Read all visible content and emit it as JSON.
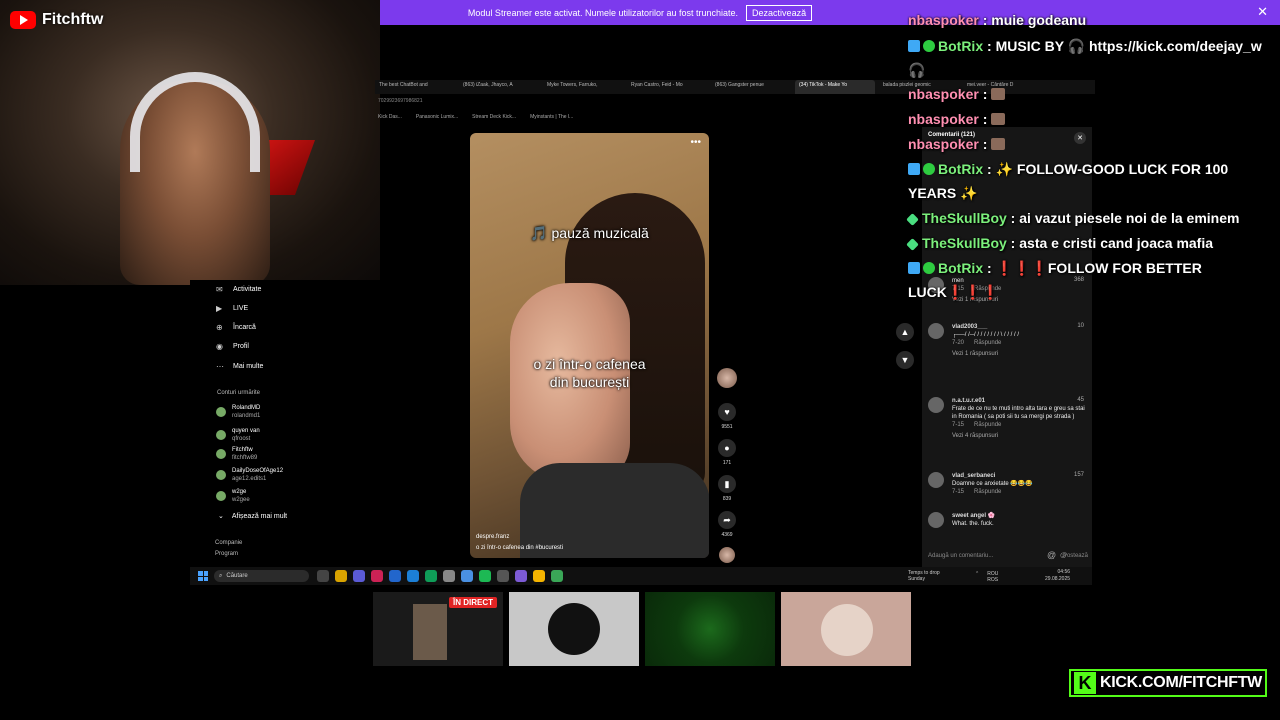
{
  "webcam": {
    "channel_name": "Fitchftw"
  },
  "banner": {
    "message": "Modul Streamer este activat. Numele utilizatorilor au fost trunchiate.",
    "button": "Dezactivează",
    "close": "✕"
  },
  "browser": {
    "tabs": [
      "The best ChatBot and",
      "(863) iZaak, Jhayco, A",
      "Myke Towers, Farruko,",
      "Ryan Castro, Feid - Mo",
      "(863) Gangster penue",
      "(34) TikTok - Make Yo",
      "balada piszlei geomic",
      "mei.veer - Cântăre D"
    ],
    "url": "7029923697986821",
    "bookmarks": [
      "Kick Das...",
      "Panasonic Lumix...",
      "Stream Deck Kick...",
      "Myinstants | The l..."
    ]
  },
  "tiktok_sidebar": {
    "nav": [
      {
        "label": "Activitate",
        "icon": "bell-icon"
      },
      {
        "label": "LIVE",
        "icon": "live-icon"
      },
      {
        "label": "Încarcă",
        "icon": "upload-icon"
      },
      {
        "label": "Profil",
        "icon": "profile-icon"
      },
      {
        "label": "Mai multe",
        "icon": "more-icon"
      }
    ],
    "following_header": "Conturi urmărite",
    "following": [
      {
        "name": "RolandMD",
        "handle": "rolandmd1"
      },
      {
        "name": "quyen van",
        "handle": "qfroost"
      },
      {
        "name": "Fitchftw",
        "handle": "fitchftw89"
      },
      {
        "name": "DailyDoseOfAge12",
        "handle": "age12.edits1"
      },
      {
        "name": "w2ge",
        "handle": "w2gee"
      }
    ],
    "show_more": "Afișează mai mult",
    "footer": [
      "Companie",
      "Program"
    ]
  },
  "video": {
    "text_top": "🎵 pauză muzicală",
    "text_middle": "o zi într-o cafenea\ndin bucurești",
    "author": "despre.franz",
    "description": "o zi într-o cafenea din #bucuresti"
  },
  "actions": {
    "likes": "9551",
    "comments": "171",
    "saves": "839",
    "shares": "4369"
  },
  "comments_panel": {
    "title": "Comentarii (121)",
    "items": [
      {
        "user": "",
        "text": "men",
        "date": "7-15",
        "reply": "Răspunde",
        "likes": "368",
        "replies": "Vezi 1 răspunsuri"
      },
      {
        "user": "vlad2003___",
        "text": "┌──/ /─/ / / / / /  / / \\ / / / / /",
        "date": "7-20",
        "reply": "Răspunde",
        "likes": "10",
        "replies": "Vezi 1 răspunsuri"
      },
      {
        "user": "n.a.t.u.r.e01",
        "text": "Frate de ce nu te muti intro alta tara e greu sa stai in Romania ( sa poti sii tu sa mergi pe strada )",
        "date": "7-15",
        "reply": "Răspunde",
        "likes": "45",
        "replies": "Vezi 4 răspunsuri"
      },
      {
        "user": "vlad_serbaneci",
        "text": "Doamne ce anxietate 😂😂😂",
        "date": "7-15",
        "reply": "Răspunde",
        "likes": "157",
        "replies": ""
      },
      {
        "user": "sweet angel 🌸",
        "text": "What. the. fuck.",
        "date": "",
        "reply": "",
        "likes": "",
        "replies": ""
      }
    ],
    "input_placeholder": "Adaugă un comentariu...",
    "post": "Postează"
  },
  "taskbar": {
    "search_placeholder": "Căutare",
    "weather_line1": "Temps to drop",
    "weather_line2": "Sunday",
    "lang": "ROU\nROS",
    "time": "04:56",
    "date": "29.08.2025"
  },
  "thumbnails": {
    "live_badge": "ÎN DIRECT"
  },
  "chat": [
    {
      "user": "nbaspoker",
      "text": "muie godeanu",
      "style": "poker",
      "badges": []
    },
    {
      "user": "BotRix",
      "text": "MUSIC BY 🎧 https://kick.com/deejay_w",
      "cont": "🎧",
      "style": "botrix",
      "badges": [
        "blue",
        "green"
      ]
    },
    {
      "user": "nbaspoker",
      "text": "",
      "style": "poker",
      "badges": [],
      "emoji": true
    },
    {
      "user": "nbaspoker",
      "text": "",
      "style": "poker",
      "badges": [],
      "emoji": true
    },
    {
      "user": "nbaspoker",
      "text": "",
      "style": "poker",
      "badges": [],
      "emoji": true
    },
    {
      "user": "BotRix",
      "text": "✨ FOLLOW-GOOD LUCK FOR 100",
      "cont": "YEARS ✨",
      "style": "botrix",
      "badges": [
        "blue",
        "green"
      ]
    },
    {
      "user": "TheSkullBoy",
      "text": "ai vazut piesele noi de la eminem",
      "style": "skull",
      "badges": [
        "dia"
      ]
    },
    {
      "user": "TheSkullBoy",
      "text": "asta e cristi cand joaca mafia",
      "style": "skull",
      "badges": [
        "dia"
      ]
    },
    {
      "user": "BotRix",
      "text": "❗❗❗FOLLOW FOR BETTER LUCK❗❗❗",
      "style": "botrix",
      "badges": [
        "blue",
        "green"
      ]
    }
  ],
  "kick": {
    "letter": "K",
    "url": "KICK.COM/FITCHFTW"
  },
  "colors": {
    "kick_green": "#53fc18",
    "banner_purple": "#7c3aed",
    "live_red": "#e02424",
    "botrix_green": "#7cf07c",
    "poker_pink": "#ff8fb1"
  }
}
